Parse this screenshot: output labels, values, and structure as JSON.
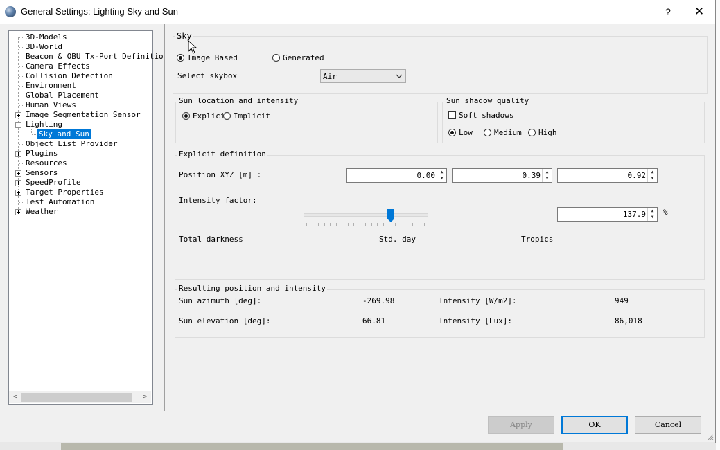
{
  "window": {
    "title": "General Settings: Lighting Sky and Sun",
    "help": "?",
    "close": "✕"
  },
  "tree": {
    "items": [
      {
        "label": "3D-Models"
      },
      {
        "label": "3D-World"
      },
      {
        "label": "Beacon & OBU Tx-Port Definitio"
      },
      {
        "label": "Camera Effects"
      },
      {
        "label": "Collision Detection"
      },
      {
        "label": "Environment"
      },
      {
        "label": "Global Placement"
      },
      {
        "label": "Human Views"
      },
      {
        "label": "Image Segmentation Sensor"
      },
      {
        "label": "Lighting"
      },
      {
        "label": "Sky and Sun"
      },
      {
        "label": "Object List Provider"
      },
      {
        "label": "Plugins"
      },
      {
        "label": "Resources"
      },
      {
        "label": "Sensors"
      },
      {
        "label": "SpeedProfile"
      },
      {
        "label": "Target Properties"
      },
      {
        "label": "Test Automation"
      },
      {
        "label": "Weather"
      }
    ],
    "scroll_left": "<",
    "scroll_right": ">"
  },
  "sky": {
    "title": "Sky",
    "image_based": "Image Based",
    "generated": "Generated",
    "select_skybox_label": "Select skybox",
    "skybox_value": "Air"
  },
  "sun_location": {
    "title": "Sun location and intensity",
    "explicit": "Explici",
    "implicit": "Implicit"
  },
  "sun_shadow": {
    "title": "Sun shadow quality",
    "soft_shadows": "Soft shadows",
    "low": "Low",
    "medium": "Medium",
    "high": "High"
  },
  "explicit_definition": {
    "title": "Explicit definition",
    "position_label": "Position XYZ [m] :",
    "pos_x": "0.00",
    "pos_y": "0.39",
    "pos_z": "0.92",
    "intensity_label": "Intensity factor:",
    "intensity_value": "137.9",
    "percent": "%",
    "slider_fraction": 0.72,
    "total_darkness": "Total darkness",
    "std_day": "Std. day",
    "tropics": "Tropics"
  },
  "result": {
    "title": "Resulting position and intensity",
    "azimuth_label": "Sun azimuth [deg]:",
    "azimuth_value": "-269.98",
    "elevation_label": "Sun elevation [deg]:",
    "elevation_value": "66.81",
    "intensity_w_label": "Intensity [W/m2]:",
    "intensity_w_value": "949",
    "intensity_lux_label": "Intensity [Lux]:",
    "intensity_lux_value": "86,018"
  },
  "buttons": {
    "apply": "Apply",
    "ok": "OK",
    "cancel": "Cancel"
  }
}
